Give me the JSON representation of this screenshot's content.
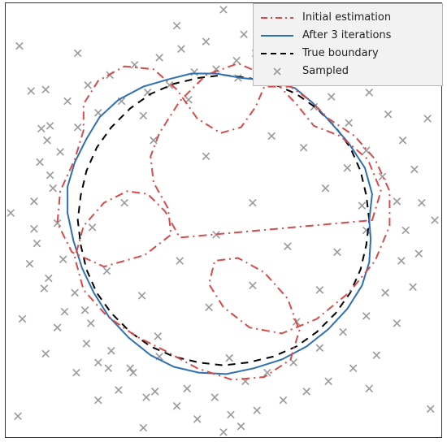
{
  "legend": {
    "items": [
      {
        "label": "Initial estimation"
      },
      {
        "label": "After 3 iterations"
      },
      {
        "label": "True boundary"
      },
      {
        "label": "Sampled"
      }
    ]
  },
  "colors": {
    "initial": "#d64a4a",
    "after3": "#2f6fb3",
    "true_boundary": "#000000",
    "sampled": "#9a9a9a",
    "legend_bg": "#f2f2f2",
    "legend_border": "#b7b7b7"
  },
  "chart_data": {
    "type": "scatter",
    "title": "",
    "xlabel": "",
    "ylabel": "",
    "xlim": [
      -1.5,
      1.5
    ],
    "ylim": [
      -1.5,
      1.5
    ],
    "series": [
      {
        "name": "Sampled",
        "style": "x-markers",
        "color": "#9a9a9a",
        "points": [
          [
            -1.32,
            0.89
          ],
          [
            -1.25,
            0.63
          ],
          [
            -1.21,
            0.55
          ],
          [
            -1.19,
            0.31
          ],
          [
            -1.3,
            -0.06
          ],
          [
            -1.33,
            -0.3
          ],
          [
            -1.23,
            -0.47
          ],
          [
            -1.14,
            -0.74
          ],
          [
            -1.22,
            -0.92
          ],
          [
            -1.01,
            -1.05
          ],
          [
            -0.95,
            -0.62
          ],
          [
            -0.86,
            -0.98
          ],
          [
            -0.72,
            -1.17
          ],
          [
            -0.64,
            -1.02
          ],
          [
            -0.53,
            -1.22
          ],
          [
            -0.44,
            -0.94
          ],
          [
            -0.32,
            -1.28
          ],
          [
            -0.25,
            -1.16
          ],
          [
            -0.18,
            -1.37
          ],
          [
            -0.06,
            -1.22
          ],
          [
            0.05,
            -1.34
          ],
          [
            0.15,
            -1.11
          ],
          [
            0.23,
            -1.31
          ],
          [
            0.3,
            -1.05
          ],
          [
            0.41,
            -1.24
          ],
          [
            0.48,
            -0.98
          ],
          [
            0.57,
            -1.18
          ],
          [
            0.66,
            -0.88
          ],
          [
            0.72,
            -1.11
          ],
          [
            0.82,
            -0.77
          ],
          [
            0.89,
            -1.02
          ],
          [
            0.98,
            -0.66
          ],
          [
            1.05,
            -0.93
          ],
          [
            1.11,
            -0.5
          ],
          [
            1.19,
            -0.71
          ],
          [
            1.22,
            -0.28
          ],
          [
            1.3,
            -0.46
          ],
          [
            1.25,
            -0.07
          ],
          [
            1.34,
            -0.23
          ],
          [
            1.19,
            0.13
          ],
          [
            1.31,
            0.35
          ],
          [
            1.09,
            0.3
          ],
          [
            1.23,
            0.55
          ],
          [
            0.98,
            0.48
          ],
          [
            1.13,
            0.73
          ],
          [
            0.86,
            0.67
          ],
          [
            1.0,
            0.88
          ],
          [
            0.74,
            0.85
          ],
          [
            0.87,
            1.01
          ],
          [
            0.63,
            0.99
          ],
          [
            0.73,
            1.14
          ],
          [
            0.5,
            1.08
          ],
          [
            0.58,
            1.23
          ],
          [
            0.36,
            1.12
          ],
          [
            0.44,
            1.3
          ],
          [
            0.22,
            1.15
          ],
          [
            0.3,
            1.33
          ],
          [
            0.09,
            1.1
          ],
          [
            0.14,
            1.28
          ],
          [
            -0.05,
            1.04
          ],
          [
            -0.12,
            1.23
          ],
          [
            -0.2,
            1.02
          ],
          [
            -0.29,
            1.18
          ],
          [
            -0.37,
            0.93
          ],
          [
            -0.44,
            1.12
          ],
          [
            -0.52,
            0.88
          ],
          [
            -0.61,
            1.07
          ],
          [
            -0.7,
            0.82
          ],
          [
            -0.78,
            1.0
          ],
          [
            -0.86,
            0.74
          ],
          [
            -0.93,
            0.93
          ],
          [
            -1.0,
            0.64
          ],
          [
            -1.07,
            0.82
          ],
          [
            -1.12,
            0.47
          ],
          [
            -1.19,
            0.65
          ],
          [
            -1.17,
            0.22
          ],
          [
            -1.26,
            0.4
          ],
          [
            -1.14,
            -0.02
          ],
          [
            -1.3,
            0.13
          ],
          [
            -1.1,
            -0.27
          ],
          [
            -1.28,
            -0.16
          ],
          [
            -1.02,
            -0.5
          ],
          [
            -1.2,
            -0.4
          ],
          [
            -0.91,
            -0.71
          ],
          [
            -1.09,
            -0.63
          ],
          [
            -0.77,
            -0.9
          ],
          [
            -0.94,
            -0.85
          ],
          [
            -0.62,
            -1.05
          ],
          [
            -0.79,
            -1.02
          ],
          [
            -0.47,
            -1.18
          ],
          [
            0.95,
            0.1
          ],
          [
            0.98,
            -0.07
          ],
          [
            0.5,
            -0.7
          ],
          [
            0.04,
            -0.95
          ],
          [
            -0.45,
            -0.8
          ],
          [
            -0.8,
            -0.35
          ],
          [
            -0.55,
            0.72
          ],
          [
            0.1,
            0.98
          ],
          [
            0.62,
            0.78
          ],
          [
            0.85,
            0.36
          ],
          [
            -1.4,
            1.2
          ],
          [
            1.38,
            1.1
          ],
          [
            1.42,
            -1.3
          ],
          [
            -1.41,
            -1.35
          ],
          [
            0.0,
            1.45
          ],
          [
            0.0,
            -1.46
          ],
          [
            1.45,
            0.0
          ],
          [
            -1.46,
            0.05
          ],
          [
            1.4,
            0.7
          ],
          [
            -1.38,
            -0.68
          ],
          [
            0.6,
            1.42
          ],
          [
            -0.55,
            -1.43
          ],
          [
            0.33,
            0.58
          ],
          [
            -0.12,
            0.44
          ],
          [
            0.44,
            -0.18
          ],
          [
            -0.3,
            -0.28
          ],
          [
            0.2,
            0.12
          ],
          [
            -0.05,
            -0.1
          ],
          [
            -0.68,
            0.12
          ],
          [
            0.66,
            -0.48
          ],
          [
            -1.0,
            1.15
          ],
          [
            -0.32,
            1.34
          ],
          [
            0.92,
            1.18
          ],
          [
            1.14,
            0.96
          ],
          [
            1.36,
            0.12
          ],
          [
            1.0,
            -1.16
          ],
          [
            0.12,
            -1.42
          ],
          [
            -0.86,
            -1.24
          ],
          [
            -1.22,
            0.9
          ],
          [
            -0.1,
            -0.6
          ],
          [
            0.55,
            0.5
          ],
          [
            -0.48,
            0.55
          ],
          [
            0.78,
            -0.22
          ],
          [
            -0.9,
            -0.05
          ],
          [
            0.2,
            -0.45
          ],
          [
            -0.24,
            0.83
          ],
          [
            0.7,
            0.22
          ],
          [
            -0.56,
            -0.52
          ]
        ]
      },
      {
        "name": "True boundary",
        "style": "dashed",
        "color": "#000000",
        "closed": true,
        "points": [
          [
            1.0,
            0.0
          ],
          [
            0.98,
            0.17
          ],
          [
            0.94,
            0.34
          ],
          [
            0.87,
            0.5
          ],
          [
            0.77,
            0.64
          ],
          [
            0.64,
            0.77
          ],
          [
            0.5,
            0.87
          ],
          [
            0.34,
            0.94
          ],
          [
            0.17,
            0.98
          ],
          [
            0.0,
            1.0
          ],
          [
            -0.17,
            0.98
          ],
          [
            -0.34,
            0.94
          ],
          [
            -0.5,
            0.87
          ],
          [
            -0.64,
            0.77
          ],
          [
            -0.77,
            0.64
          ],
          [
            -0.87,
            0.5
          ],
          [
            -0.94,
            0.34
          ],
          [
            -0.98,
            0.17
          ],
          [
            -1.0,
            0.0
          ],
          [
            -0.98,
            -0.17
          ],
          [
            -0.94,
            -0.34
          ],
          [
            -0.87,
            -0.5
          ],
          [
            -0.77,
            -0.64
          ],
          [
            -0.64,
            -0.77
          ],
          [
            -0.5,
            -0.87
          ],
          [
            -0.34,
            -0.94
          ],
          [
            -0.17,
            -0.98
          ],
          [
            0.0,
            -1.0
          ],
          [
            0.17,
            -0.98
          ],
          [
            0.34,
            -0.94
          ],
          [
            0.5,
            -0.87
          ],
          [
            0.64,
            -0.77
          ],
          [
            0.77,
            -0.64
          ],
          [
            0.87,
            -0.5
          ],
          [
            0.94,
            -0.34
          ],
          [
            0.98,
            -0.17
          ]
        ]
      },
      {
        "name": "After 3 iterations",
        "style": "solid",
        "color": "#2f6fb3",
        "closed": true,
        "points": [
          [
            1.0,
            0.0
          ],
          [
            1.02,
            0.18
          ],
          [
            0.97,
            0.36
          ],
          [
            0.86,
            0.53
          ],
          [
            0.73,
            0.68
          ],
          [
            0.61,
            0.81
          ],
          [
            0.49,
            0.91
          ],
          [
            0.32,
            0.96
          ],
          [
            0.12,
            0.98
          ],
          [
            -0.05,
            1.01
          ],
          [
            -0.22,
            1.01
          ],
          [
            -0.38,
            0.97
          ],
          [
            -0.55,
            0.92
          ],
          [
            -0.72,
            0.83
          ],
          [
            -0.85,
            0.71
          ],
          [
            -0.94,
            0.56
          ],
          [
            -1.02,
            0.4
          ],
          [
            -1.07,
            0.23
          ],
          [
            -1.07,
            0.05
          ],
          [
            -1.03,
            -0.14
          ],
          [
            -0.97,
            -0.33
          ],
          [
            -0.89,
            -0.5
          ],
          [
            -0.79,
            -0.66
          ],
          [
            -0.65,
            -0.81
          ],
          [
            -0.5,
            -0.93
          ],
          [
            -0.34,
            -1.01
          ],
          [
            -0.17,
            -1.05
          ],
          [
            0.02,
            -1.06
          ],
          [
            0.21,
            -1.02
          ],
          [
            0.4,
            -0.96
          ],
          [
            0.57,
            -0.87
          ],
          [
            0.72,
            -0.75
          ],
          [
            0.85,
            -0.61
          ],
          [
            0.95,
            -0.45
          ],
          [
            1.0,
            -0.29
          ],
          [
            1.01,
            -0.13
          ]
        ]
      },
      {
        "name": "Initial estimation",
        "style": "dash-dot",
        "color": "#d64a4a",
        "closed": true,
        "points": [
          [
            1.02,
            0.0
          ],
          [
            1.08,
            0.2
          ],
          [
            0.99,
            0.42
          ],
          [
            0.8,
            0.58
          ],
          [
            0.62,
            0.65
          ],
          [
            0.5,
            0.8
          ],
          [
            0.33,
            0.98
          ],
          [
            0.1,
            1.08
          ],
          [
            -0.12,
            1.0
          ],
          [
            -0.3,
            0.82
          ],
          [
            -0.44,
            0.6
          ],
          [
            -0.5,
            0.44
          ],
          [
            -0.48,
            0.26
          ],
          [
            -0.38,
            0.08
          ],
          [
            -0.36,
            -0.1
          ],
          [
            -0.54,
            -0.24
          ],
          [
            -0.82,
            -0.32
          ],
          [
            -1.04,
            -0.22
          ],
          [
            -1.14,
            -0.02
          ],
          [
            -1.12,
            0.2
          ],
          [
            -1.02,
            0.42
          ],
          [
            -0.96,
            0.62
          ],
          [
            -0.96,
            0.8
          ],
          [
            -0.86,
            0.96
          ],
          [
            -0.68,
            1.06
          ],
          [
            -0.48,
            1.04
          ],
          [
            -0.32,
            0.9
          ],
          [
            -0.18,
            0.7
          ],
          [
            -0.02,
            0.6
          ],
          [
            0.12,
            0.64
          ],
          [
            0.22,
            0.78
          ],
          [
            0.28,
            0.92
          ],
          [
            0.46,
            0.92
          ],
          [
            0.6,
            0.82
          ],
          [
            0.72,
            0.7
          ],
          [
            0.9,
            0.58
          ],
          [
            1.04,
            0.42
          ],
          [
            1.14,
            0.2
          ],
          [
            1.14,
            -0.04
          ],
          [
            1.04,
            -0.28
          ],
          [
            0.86,
            -0.5
          ],
          [
            0.64,
            -0.68
          ],
          [
            0.4,
            -0.78
          ],
          [
            0.18,
            -0.74
          ],
          [
            0.0,
            -0.6
          ],
          [
            -0.1,
            -0.44
          ],
          [
            -0.06,
            -0.28
          ],
          [
            0.1,
            -0.26
          ],
          [
            0.28,
            -0.36
          ],
          [
            0.44,
            -0.54
          ],
          [
            0.52,
            -0.76
          ],
          [
            0.46,
            -0.96
          ],
          [
            0.28,
            -1.08
          ],
          [
            0.06,
            -1.1
          ],
          [
            -0.18,
            -1.02
          ],
          [
            -0.4,
            -0.9
          ],
          [
            -0.6,
            -0.8
          ],
          [
            -0.8,
            -0.66
          ],
          [
            -0.96,
            -0.48
          ],
          [
            -1.02,
            -0.26
          ],
          [
            -0.96,
            -0.04
          ],
          [
            -0.82,
            0.12
          ],
          [
            -0.66,
            0.2
          ],
          [
            -0.52,
            0.18
          ],
          [
            -0.4,
            0.06
          ],
          [
            -0.3,
            -0.12
          ]
        ]
      }
    ]
  }
}
